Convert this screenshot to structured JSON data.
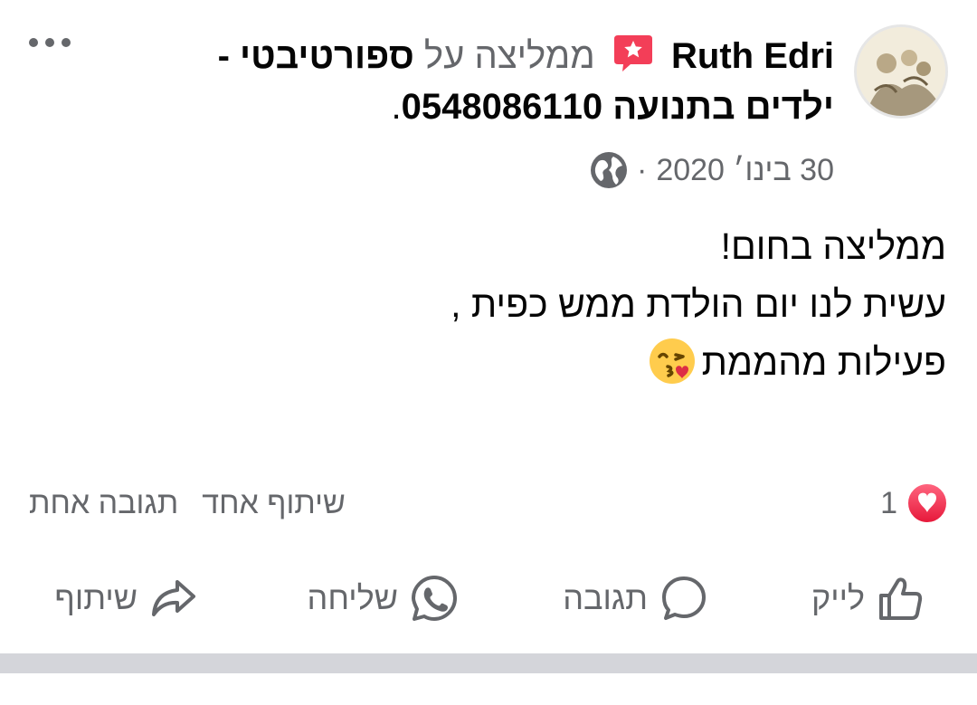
{
  "post": {
    "author": "Ruth Edri",
    "verb": "ממליצה על",
    "page_name": "ספורטיבטי -ילדים בתנועה 0548086110",
    "page_name_suffix": ".",
    "date": "30 בינו׳ 2020",
    "separator": "·",
    "privacy_icon": "globe-icon",
    "body_lines": [
      "ממליצה בחום!",
      "עשית לנו יום הולדת ממש כפית ,",
      "פעילות מהממת"
    ],
    "body_emoji": "face-blowing-kiss-emoji"
  },
  "stats": {
    "reaction_icon": "love-reaction-icon",
    "reaction_count": "1",
    "comments": "תגובה אחת",
    "shares": "שיתוף אחד"
  },
  "actions": {
    "like": "לייק",
    "comment": "תגובה",
    "send": "שליחה",
    "share": "שיתוף"
  },
  "colors": {
    "text": "#050505",
    "secondary": "#65676b",
    "love_red": "#f33e58",
    "divider_band": "#d4d5da"
  }
}
